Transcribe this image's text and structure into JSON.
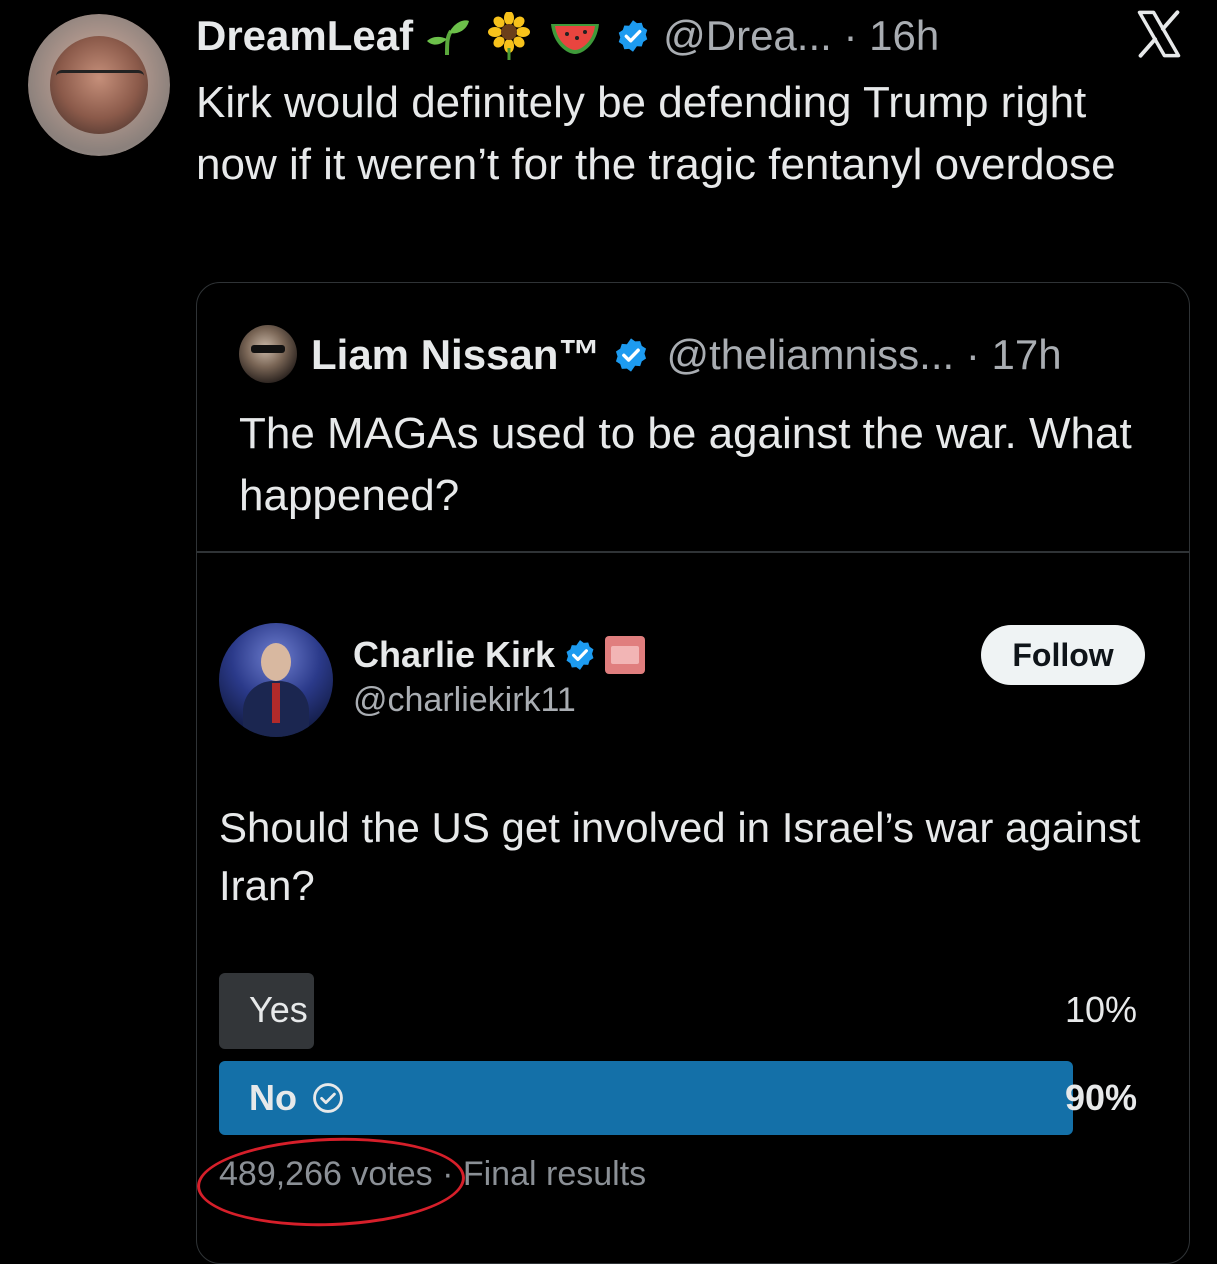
{
  "tweet": {
    "display_name": "DreamLeaf",
    "emojis": [
      "seedling-icon",
      "sunflower-icon",
      "watermelon-icon"
    ],
    "handle": "@Drea...",
    "separator": "·",
    "time": "16h",
    "text": "Kirk would definitely be defending Trump right now if it weren’t for the tragic fentanyl overdose"
  },
  "quote": {
    "display_name": "Liam Nissan™",
    "handle": "@theliamniss...",
    "separator": "·",
    "time": "17h",
    "text": "The MAGAs used to be against the war. What happened?"
  },
  "embedded": {
    "display_name": "Charlie Kirk",
    "handle": "@charliekirk11",
    "follow_label": "Follow",
    "poll": {
      "question": "Should the US get involved in Israel’s war against Iran?",
      "options": [
        {
          "label": "Yes",
          "percent_text": "10%",
          "percent": 10,
          "selected": false
        },
        {
          "label": "No",
          "percent_text": "90%",
          "percent": 90,
          "selected": true
        }
      ],
      "votes": "489,266 votes",
      "separator": "·",
      "status": "Final results"
    }
  },
  "colors": {
    "background": "#000000",
    "text": "#e7e9ea",
    "muted": "#a9adb2",
    "verified_blue": "#1d9bf0",
    "poll_winner": "#1470a8",
    "poll_loser": "#333639",
    "annotation_red": "#d61f2a"
  },
  "icons": {
    "platform_logo": "x-logo-icon",
    "verified": "verified-badge-icon",
    "winner_check": "check-circle-icon"
  }
}
